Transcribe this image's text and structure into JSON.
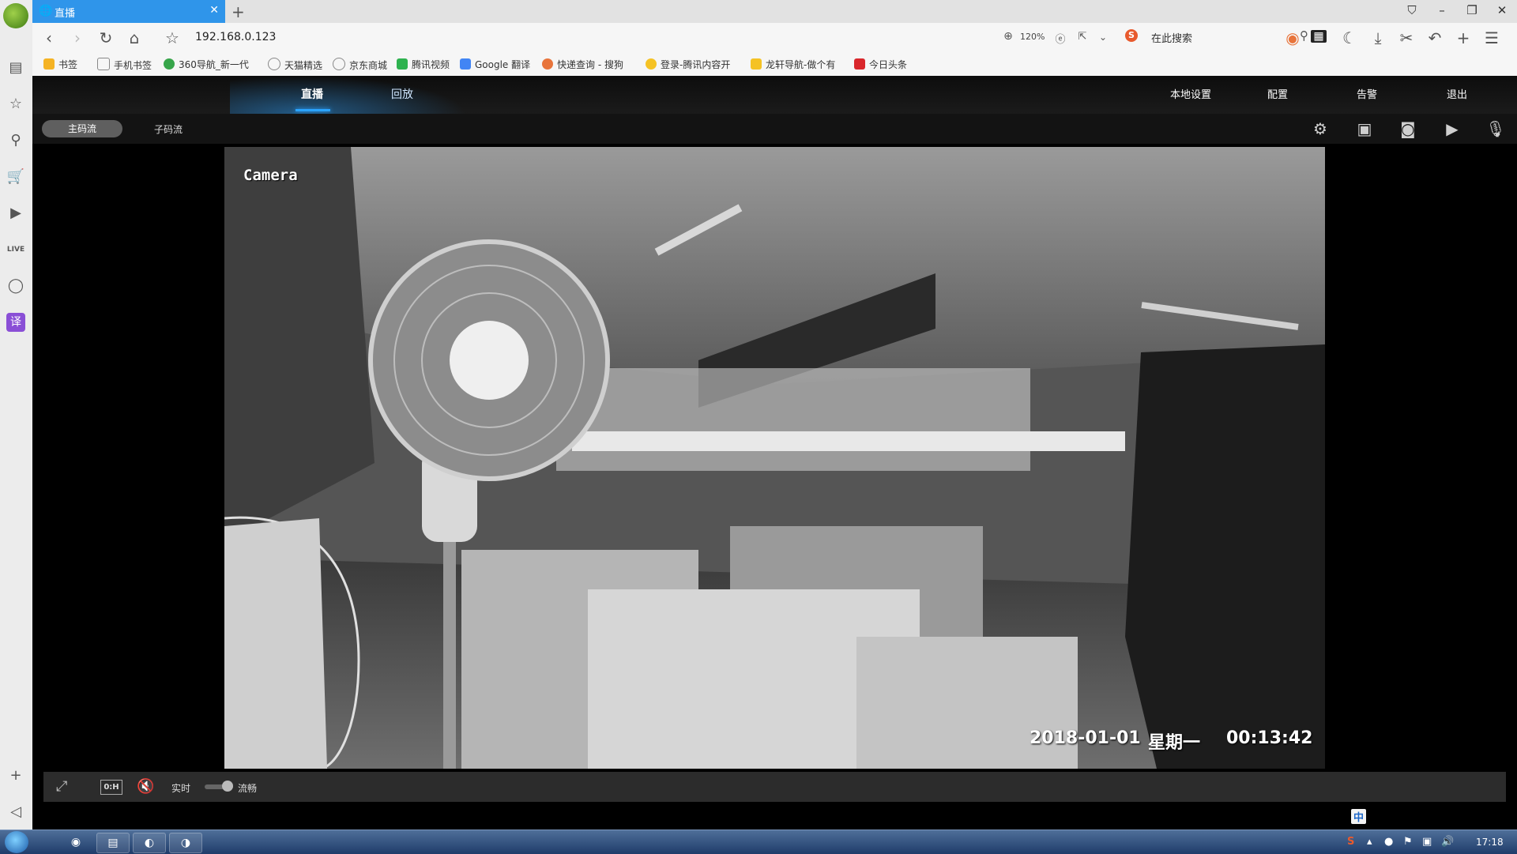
{
  "browser": {
    "tab_title": "直播",
    "new_tab": "+",
    "address": "192.168.0.123",
    "zoom": "120%",
    "search_placeholder": "在此搜索",
    "search_logo": "S",
    "bookmarks": [
      "书签",
      "手机书签",
      "360导航_新一代",
      "天猫精选",
      "京东商城",
      "腾讯视频",
      "Google 翻译",
      "快递查询 - 搜狗",
      "登录-腾讯内容开",
      "龙轩导航-做个有",
      "今日头条"
    ]
  },
  "app": {
    "nav": {
      "live": "直播",
      "playback": "回放"
    },
    "right_nav": {
      "local_settings": "本地设置",
      "config": "配置",
      "alarm": "告警",
      "logout": "退出"
    },
    "stream": {
      "main": "主码流",
      "sub": "子码流"
    },
    "osd": {
      "camera_name": "Camera",
      "date": "2018-01-01",
      "weekday": "星期一",
      "time": "00:13:42"
    },
    "bottom": {
      "ratio": "0:H",
      "realtime": "实时",
      "smooth": "流畅"
    }
  },
  "taskbar": {
    "clock": "17:18",
    "ime": "中"
  },
  "colors": {
    "tab_active": "#2f95ea",
    "accent": "#2aa3ff"
  }
}
